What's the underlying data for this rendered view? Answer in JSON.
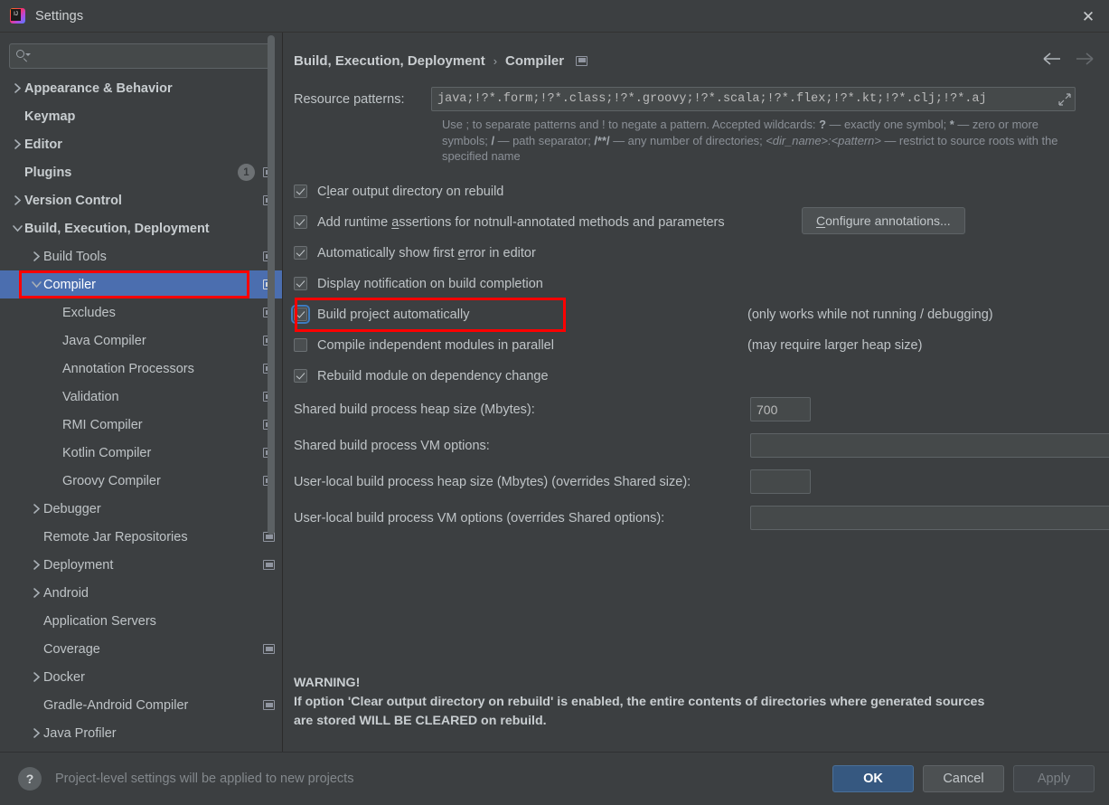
{
  "window": {
    "title": "Settings",
    "app_icon": "intellij-idea-icon",
    "close_icon": "close-icon"
  },
  "sidebar": {
    "search": {
      "value": "",
      "placeholder": "",
      "icon": "search-icon"
    },
    "items": [
      {
        "label": "Appearance & Behavior",
        "indent": 0,
        "arrow": "right",
        "bold": true,
        "badge": null,
        "proj": false,
        "selected": false
      },
      {
        "label": "Keymap",
        "indent": 0,
        "arrow": "none",
        "bold": true,
        "badge": null,
        "proj": false,
        "selected": false
      },
      {
        "label": "Editor",
        "indent": 0,
        "arrow": "right",
        "bold": true,
        "badge": null,
        "proj": false,
        "selected": false
      },
      {
        "label": "Plugins",
        "indent": 0,
        "arrow": "none",
        "bold": true,
        "badge": "1",
        "proj": true,
        "selected": false
      },
      {
        "label": "Version Control",
        "indent": 0,
        "arrow": "right",
        "bold": true,
        "badge": null,
        "proj": true,
        "selected": false
      },
      {
        "label": "Build, Execution, Deployment",
        "indent": 0,
        "arrow": "down",
        "bold": true,
        "badge": null,
        "proj": false,
        "selected": false
      },
      {
        "label": "Build Tools",
        "indent": 1,
        "arrow": "right",
        "bold": false,
        "badge": null,
        "proj": true,
        "selected": false
      },
      {
        "label": "Compiler",
        "indent": 1,
        "arrow": "down",
        "bold": false,
        "badge": null,
        "proj": true,
        "selected": true
      },
      {
        "label": "Excludes",
        "indent": 2,
        "arrow": "none",
        "bold": false,
        "badge": null,
        "proj": true,
        "selected": false
      },
      {
        "label": "Java Compiler",
        "indent": 2,
        "arrow": "none",
        "bold": false,
        "badge": null,
        "proj": true,
        "selected": false
      },
      {
        "label": "Annotation Processors",
        "indent": 2,
        "arrow": "none",
        "bold": false,
        "badge": null,
        "proj": true,
        "selected": false
      },
      {
        "label": "Validation",
        "indent": 2,
        "arrow": "none",
        "bold": false,
        "badge": null,
        "proj": true,
        "selected": false
      },
      {
        "label": "RMI Compiler",
        "indent": 2,
        "arrow": "none",
        "bold": false,
        "badge": null,
        "proj": true,
        "selected": false
      },
      {
        "label": "Kotlin Compiler",
        "indent": 2,
        "arrow": "none",
        "bold": false,
        "badge": null,
        "proj": true,
        "selected": false
      },
      {
        "label": "Groovy Compiler",
        "indent": 2,
        "arrow": "none",
        "bold": false,
        "badge": null,
        "proj": true,
        "selected": false
      },
      {
        "label": "Debugger",
        "indent": 1,
        "arrow": "right",
        "bold": false,
        "badge": null,
        "proj": false,
        "selected": false
      },
      {
        "label": "Remote Jar Repositories",
        "indent": 1,
        "arrow": "none",
        "bold": false,
        "badge": null,
        "proj": true,
        "selected": false
      },
      {
        "label": "Deployment",
        "indent": 1,
        "arrow": "right",
        "bold": false,
        "badge": null,
        "proj": true,
        "selected": false
      },
      {
        "label": "Android",
        "indent": 1,
        "arrow": "right",
        "bold": false,
        "badge": null,
        "proj": false,
        "selected": false
      },
      {
        "label": "Application Servers",
        "indent": 1,
        "arrow": "none",
        "bold": false,
        "badge": null,
        "proj": false,
        "selected": false
      },
      {
        "label": "Coverage",
        "indent": 1,
        "arrow": "none",
        "bold": false,
        "badge": null,
        "proj": true,
        "selected": false
      },
      {
        "label": "Docker",
        "indent": 1,
        "arrow": "right",
        "bold": false,
        "badge": null,
        "proj": false,
        "selected": false
      },
      {
        "label": "Gradle-Android Compiler",
        "indent": 1,
        "arrow": "none",
        "bold": false,
        "badge": null,
        "proj": true,
        "selected": false
      },
      {
        "label": "Java Profiler",
        "indent": 1,
        "arrow": "right",
        "bold": false,
        "badge": null,
        "proj": false,
        "selected": false
      }
    ]
  },
  "main": {
    "breadcrumb": {
      "parent": "Build, Execution, Deployment",
      "separator": "›",
      "current": "Compiler",
      "proj_icon": "project-level-icon"
    },
    "nav": {
      "back_icon": "arrow-left-icon",
      "forward_icon": "arrow-right-icon"
    },
    "resource_patterns": {
      "label": "Resource patterns:",
      "value": "java;!?*.form;!?*.class;!?*.groovy;!?*.scala;!?*.flex;!?*.kt;!?*.clj;!?*.aj",
      "expand_icon": "expand-icon",
      "hint_1": "Use ; to separate patterns and ! to negate a pattern. Accepted wildcards: ",
      "hint_q": "?",
      "hint_2": " — exactly one symbol; ",
      "hint_star": "*",
      "hint_3": " — zero or more symbols; ",
      "hint_slash": "/",
      "hint_4": " — path separator; ",
      "hint_dstar": "/**/",
      "hint_5": " — any number of directories;  ",
      "hint_dir": "<dir_name>:<pattern>",
      "hint_6": " — restrict to source roots with the specified name"
    },
    "checkboxes": [
      {
        "label_pre": "C",
        "mnemonic": "l",
        "label_post": "ear output directory on rebuild",
        "checked": true,
        "focused": false,
        "note": ""
      },
      {
        "label_pre": "Add runtime ",
        "mnemonic": "a",
        "label_post": "ssertions for notnull-annotated methods and parameters",
        "checked": true,
        "focused": false,
        "note": ""
      },
      {
        "label_pre": "Automatically show first ",
        "mnemonic": "e",
        "label_post": "rror in editor",
        "checked": true,
        "focused": false,
        "note": ""
      },
      {
        "label_pre": "Display notification on build completion",
        "mnemonic": "",
        "label_post": "",
        "checked": true,
        "focused": false,
        "note": ""
      },
      {
        "label_pre": "Build project automatically",
        "mnemonic": "",
        "label_post": "",
        "checked": true,
        "focused": true,
        "note": "(only works while not running / debugging)"
      },
      {
        "label_pre": "Compile independent modules in parallel",
        "mnemonic": "",
        "label_post": "",
        "checked": false,
        "focused": false,
        "note": "(may require larger heap size)"
      },
      {
        "label_pre": "Rebuild module on dependency change",
        "mnemonic": "",
        "label_post": "",
        "checked": true,
        "focused": false,
        "note": ""
      }
    ],
    "configure_annotations": {
      "pre": "C",
      "mnemonic": "C",
      "label": "onfigure annotations..."
    },
    "fields": [
      {
        "label": "Shared build process heap size (Mbytes):",
        "value": "700",
        "wide": false,
        "expand": false
      },
      {
        "label": "Shared build process VM options:",
        "value": "",
        "wide": true,
        "expand": true
      },
      {
        "label": "User-local build process heap size (Mbytes) (overrides Shared size):",
        "value": "",
        "wide": false,
        "expand": false
      },
      {
        "label": "User-local build process VM options (overrides Shared options):",
        "value": "",
        "wide": true,
        "expand": true
      }
    ],
    "warning": {
      "title": "WARNING!",
      "line1": "If option 'Clear output directory on rebuild' is enabled, the entire contents of directories where generated sources",
      "line2": "are stored WILL BE CLEARED on rebuild."
    }
  },
  "footer": {
    "help_icon": "?",
    "note": "Project-level settings will be applied to new projects",
    "ok": "OK",
    "cancel": "Cancel",
    "apply": "Apply"
  },
  "colors": {
    "background": "#3c3f41",
    "selection": "#4b6eaf",
    "accent_button": "#365880",
    "annotation": "#ff0000",
    "text": "#bfc4c7"
  }
}
